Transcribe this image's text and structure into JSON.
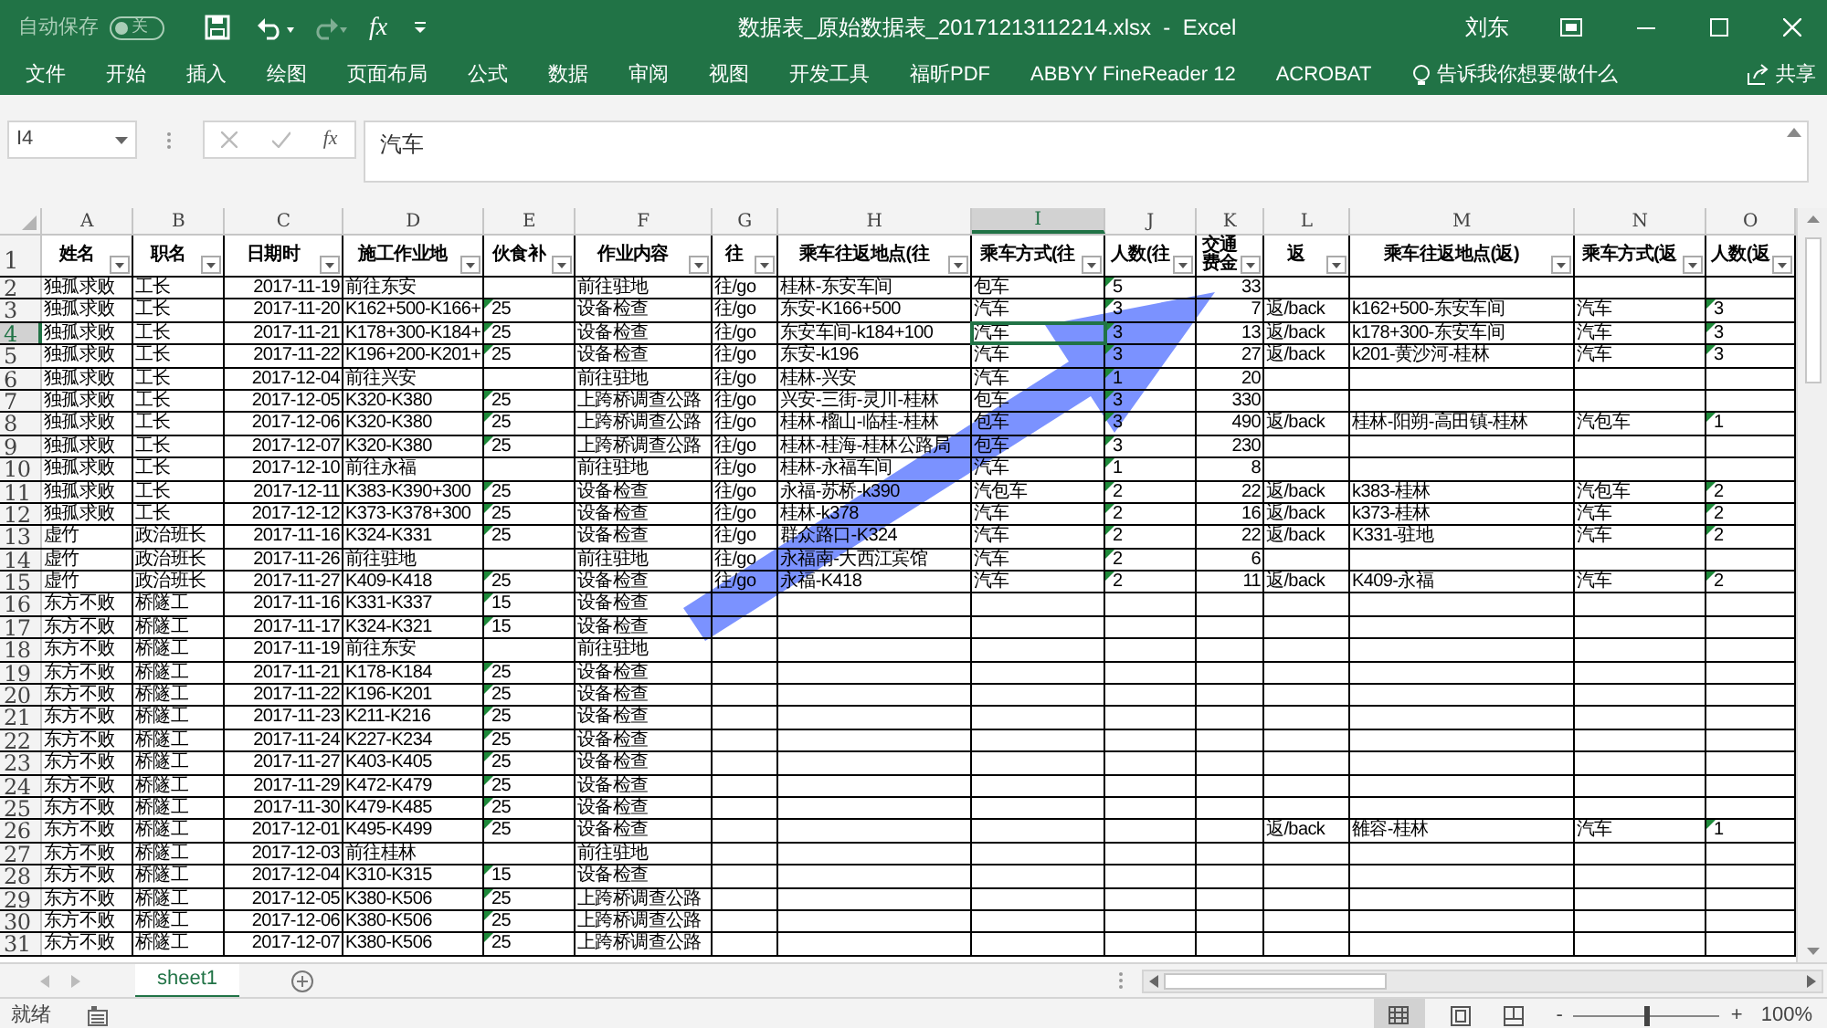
{
  "title_bar": {
    "autosave_label": "自动保存",
    "autosave_state": "关",
    "autosave_on": false,
    "fx": "fx",
    "document_title": "数据表_原始数据表_20171213112214.xlsx  -  Excel",
    "user": "刘东"
  },
  "ribbon_tabs": [
    "文件",
    "开始",
    "插入",
    "绘图",
    "页面布局",
    "公式",
    "数据",
    "审阅",
    "视图",
    "开发工具",
    "福昕PDF",
    "ABBYY FineReader 12",
    "ACROBAT"
  ],
  "tell_me": "告诉我你想要做什么",
  "share": "共享",
  "formula_bar": {
    "name_box": "I4",
    "fx": "fx",
    "formula": "汽车"
  },
  "columns": [
    {
      "letter": "A",
      "selected": false
    },
    {
      "letter": "B",
      "selected": false
    },
    {
      "letter": "C",
      "selected": false
    },
    {
      "letter": "D",
      "selected": false
    },
    {
      "letter": "E",
      "selected": false
    },
    {
      "letter": "F",
      "selected": false
    },
    {
      "letter": "G",
      "selected": false
    },
    {
      "letter": "H",
      "selected": false
    },
    {
      "letter": "I",
      "selected": true
    },
    {
      "letter": "J",
      "selected": false
    },
    {
      "letter": "K",
      "selected": false
    },
    {
      "letter": "L",
      "selected": false
    },
    {
      "letter": "M",
      "selected": false
    },
    {
      "letter": "N",
      "selected": false
    },
    {
      "letter": "O",
      "selected": false
    }
  ],
  "header_row": {
    "number": "1",
    "cells": [
      "姓名",
      "职名",
      "日期时",
      "施工作业地",
      "伙食补",
      "作业内容",
      "往",
      "乘车往返地点(往",
      "乘车方式(往",
      "人数(往",
      "交通费金",
      "返",
      "乘车往返地点(返)",
      "乘车方式(返",
      "人数(返"
    ]
  },
  "rows": [
    {
      "number": "2",
      "selected": false,
      "cells": [
        "独孤求败",
        "工长",
        "2017-11-19",
        "前往东安",
        "",
        "前往驻地",
        "往/go",
        "桂林-东安车间",
        "包车",
        {
          "text": "5",
          "flag": true
        },
        "33",
        "",
        "",
        "",
        ""
      ]
    },
    {
      "number": "3",
      "selected": false,
      "cells": [
        "独孤求败",
        "工长",
        "2017-11-20",
        "K162+500-K166+",
        {
          "text": "25",
          "flag": true
        },
        "设备检查",
        "往/go",
        "东安-K166+500",
        "汽车",
        {
          "text": "3",
          "flag": true
        },
        "7",
        "返/back",
        "k162+500-东安车间",
        "汽车",
        {
          "text": "3",
          "flag": true
        }
      ]
    },
    {
      "number": "4",
      "selected": true,
      "cells": [
        "独孤求败",
        "工长",
        "2017-11-21",
        "K178+300-K184+",
        {
          "text": "25",
          "flag": true
        },
        "设备检查",
        "往/go",
        "东安车间-k184+100",
        "汽车",
        {
          "text": "3",
          "flag": true
        },
        "13",
        "返/back",
        "k178+300-东安车间",
        "汽车",
        {
          "text": "3",
          "flag": true
        }
      ]
    },
    {
      "number": "5",
      "selected": false,
      "cells": [
        "独孤求败",
        "工长",
        "2017-11-22",
        "K196+200-K201+",
        {
          "text": "25",
          "flag": true
        },
        "设备检查",
        "往/go",
        "东安-k196",
        "汽车",
        {
          "text": "3",
          "flag": true
        },
        "27",
        "返/back",
        "k201-黄沙河-桂林",
        "汽车",
        {
          "text": "3",
          "flag": true
        }
      ]
    },
    {
      "number": "6",
      "selected": false,
      "cells": [
        "独孤求败",
        "工长",
        "2017-12-04",
        "前往兴安",
        "",
        "前往驻地",
        "往/go",
        "桂林-兴安",
        "汽车",
        {
          "text": "1",
          "flag": true
        },
        "20",
        "",
        "",
        "",
        ""
      ]
    },
    {
      "number": "7",
      "selected": false,
      "cells": [
        "独孤求败",
        "工长",
        "2017-12-05",
        "K320-K380",
        {
          "text": "25",
          "flag": true
        },
        "上跨桥调查公路",
        "往/go",
        "兴安-三街-灵川-桂林",
        "包车",
        {
          "text": "3",
          "flag": true
        },
        "330",
        "",
        "",
        "",
        ""
      ]
    },
    {
      "number": "8",
      "selected": false,
      "cells": [
        "独孤求败",
        "工长",
        "2017-12-06",
        "K320-K380",
        {
          "text": "25",
          "flag": true
        },
        "上跨桥调查公路",
        "往/go",
        "桂林-榴山-临桂-桂林",
        "包车",
        {
          "text": "3",
          "flag": true
        },
        "490",
        "返/back",
        "桂林-阳朔-高田镇-桂林",
        "汽包车",
        {
          "text": "1",
          "flag": true
        }
      ]
    },
    {
      "number": "9",
      "selected": false,
      "cells": [
        "独孤求败",
        "工长",
        "2017-12-07",
        "K320-K380",
        {
          "text": "25",
          "flag": true
        },
        "上跨桥调查公路",
        "往/go",
        "桂林-桂海-桂林公路局",
        "包车",
        {
          "text": "3",
          "flag": true
        },
        "230",
        "",
        "",
        "",
        ""
      ]
    },
    {
      "number": "10",
      "selected": false,
      "cells": [
        "独孤求败",
        "工长",
        "2017-12-10",
        "前往永福",
        "",
        "前往驻地",
        "往/go",
        "桂林-永福车间",
        "汽车",
        {
          "text": "1",
          "flag": true
        },
        "8",
        "",
        "",
        "",
        ""
      ]
    },
    {
      "number": "11",
      "selected": false,
      "cells": [
        "独孤求败",
        "工长",
        "2017-12-11",
        "K383-K390+300",
        {
          "text": "25",
          "flag": true
        },
        "设备检查",
        "往/go",
        "永福-苏桥-k390",
        "汽包车",
        {
          "text": "2",
          "flag": true
        },
        "22",
        "返/back",
        "k383-桂林",
        "汽包车",
        {
          "text": "2",
          "flag": true
        }
      ]
    },
    {
      "number": "12",
      "selected": false,
      "cells": [
        "独孤求败",
        "工长",
        "2017-12-12",
        "K373-K378+300",
        {
          "text": "25",
          "flag": true
        },
        "设备检查",
        "往/go",
        "桂林-k378",
        "汽车",
        {
          "text": "2",
          "flag": true
        },
        "16",
        "返/back",
        "k373-桂林",
        "汽车",
        {
          "text": "2",
          "flag": true
        }
      ]
    },
    {
      "number": "13",
      "selected": false,
      "cells": [
        "虚竹",
        "政治班长",
        "2017-11-16",
        "K324-K331",
        {
          "text": "25",
          "flag": true
        },
        "设备检查",
        "往/go",
        "群众路口-K324",
        "汽车",
        {
          "text": "2",
          "flag": true
        },
        "22",
        "返/back",
        "K331-驻地",
        "汽车",
        {
          "text": "2",
          "flag": true
        }
      ]
    },
    {
      "number": "14",
      "selected": false,
      "cells": [
        "虚竹",
        "政治班长",
        "2017-11-26",
        "前往驻地",
        "",
        "前往驻地",
        "往/go",
        "永福南-大西江宾馆",
        "汽车",
        {
          "text": "2",
          "flag": true
        },
        "6",
        "",
        "",
        "",
        ""
      ]
    },
    {
      "number": "15",
      "selected": false,
      "cells": [
        "虚竹",
        "政治班长",
        "2017-11-27",
        "K409-K418",
        {
          "text": "25",
          "flag": true
        },
        "设备检查",
        "往/go",
        "永福-K418",
        "汽车",
        {
          "text": "2",
          "flag": true
        },
        "11",
        "返/back",
        "K409-永福",
        "汽车",
        {
          "text": "2",
          "flag": true
        }
      ]
    },
    {
      "number": "16",
      "selected": false,
      "cells": [
        "东方不败",
        "桥隧工",
        "2017-11-16",
        "K331-K337",
        {
          "text": "15",
          "flag": true
        },
        "设备检查",
        "",
        "",
        "",
        "",
        "",
        "",
        "",
        "",
        ""
      ]
    },
    {
      "number": "17",
      "selected": false,
      "cells": [
        "东方不败",
        "桥隧工",
        "2017-11-17",
        "K324-K321",
        {
          "text": "15",
          "flag": true
        },
        "设备检查",
        "",
        "",
        "",
        "",
        "",
        "",
        "",
        "",
        ""
      ]
    },
    {
      "number": "18",
      "selected": false,
      "cells": [
        "东方不败",
        "桥隧工",
        "2017-11-19",
        "前往东安",
        "",
        "前往驻地",
        "",
        "",
        "",
        "",
        "",
        "",
        "",
        "",
        ""
      ]
    },
    {
      "number": "19",
      "selected": false,
      "cells": [
        "东方不败",
        "桥隧工",
        "2017-11-21",
        "K178-K184",
        {
          "text": "25",
          "flag": true
        },
        "设备检查",
        "",
        "",
        "",
        "",
        "",
        "",
        "",
        "",
        ""
      ]
    },
    {
      "number": "20",
      "selected": false,
      "cells": [
        "东方不败",
        "桥隧工",
        "2017-11-22",
        "K196-K201",
        {
          "text": "25",
          "flag": true
        },
        "设备检查",
        "",
        "",
        "",
        "",
        "",
        "",
        "",
        "",
        ""
      ]
    },
    {
      "number": "21",
      "selected": false,
      "cells": [
        "东方不败",
        "桥隧工",
        "2017-11-23",
        "K211-K216",
        {
          "text": "25",
          "flag": true
        },
        "设备检查",
        "",
        "",
        "",
        "",
        "",
        "",
        "",
        "",
        ""
      ]
    },
    {
      "number": "22",
      "selected": false,
      "cells": [
        "东方不败",
        "桥隧工",
        "2017-11-24",
        "K227-K234",
        {
          "text": "25",
          "flag": true
        },
        "设备检查",
        "",
        "",
        "",
        "",
        "",
        "",
        "",
        "",
        ""
      ]
    },
    {
      "number": "23",
      "selected": false,
      "cells": [
        "东方不败",
        "桥隧工",
        "2017-11-27",
        "K403-K405",
        {
          "text": "25",
          "flag": true
        },
        "设备检查",
        "",
        "",
        "",
        "",
        "",
        "",
        "",
        "",
        ""
      ]
    },
    {
      "number": "24",
      "selected": false,
      "cells": [
        "东方不败",
        "桥隧工",
        "2017-11-29",
        "K472-K479",
        {
          "text": "25",
          "flag": true
        },
        "设备检查",
        "",
        "",
        "",
        "",
        "",
        "",
        "",
        "",
        ""
      ]
    },
    {
      "number": "25",
      "selected": false,
      "cells": [
        "东方不败",
        "桥隧工",
        "2017-11-30",
        "K479-K485",
        {
          "text": "25",
          "flag": true
        },
        "设备检查",
        "",
        "",
        "",
        "",
        "",
        "",
        "",
        "",
        ""
      ]
    },
    {
      "number": "26",
      "selected": false,
      "cells": [
        "东方不败",
        "桥隧工",
        "2017-12-01",
        "K495-K499",
        {
          "text": "25",
          "flag": true
        },
        "设备检查",
        "",
        "",
        "",
        "",
        "",
        "返/back",
        "雒容-桂林",
        "汽车",
        {
          "text": "1",
          "flag": true
        }
      ]
    },
    {
      "number": "27",
      "selected": false,
      "cells": [
        "东方不败",
        "桥隧工",
        "2017-12-03",
        "前往桂林",
        "",
        "前往驻地",
        "",
        "",
        "",
        "",
        "",
        "",
        "",
        "",
        ""
      ]
    },
    {
      "number": "28",
      "selected": false,
      "cells": [
        "东方不败",
        "桥隧工",
        "2017-12-04",
        "K310-K315",
        {
          "text": "15",
          "flag": true
        },
        "设备检查",
        "",
        "",
        "",
        "",
        "",
        "",
        "",
        "",
        ""
      ]
    },
    {
      "number": "29",
      "selected": false,
      "cells": [
        "东方不败",
        "桥隧工",
        "2017-12-05",
        "K380-K506",
        {
          "text": "25",
          "flag": true
        },
        "上跨桥调查公路",
        "",
        "",
        "",
        "",
        "",
        "",
        "",
        "",
        ""
      ]
    },
    {
      "number": "30",
      "selected": false,
      "cells": [
        "东方不败",
        "桥隧工",
        "2017-12-06",
        "K380-K506",
        {
          "text": "25",
          "flag": true
        },
        "上跨桥调查公路",
        "",
        "",
        "",
        "",
        "",
        "",
        "",
        "",
        ""
      ]
    },
    {
      "number": "31",
      "selected": false,
      "cells": [
        "东方不败",
        "桥隧工",
        "2017-12-07",
        "K380-K506",
        {
          "text": "25",
          "flag": true
        },
        "上跨桥调查公路",
        "",
        "",
        "",
        "",
        "",
        "",
        "",
        "",
        ""
      ]
    }
  ],
  "sheet_tabs": [
    {
      "label": "sheet1",
      "selected": true
    }
  ],
  "status_bar": {
    "text": "就绪",
    "zoom_minus": "-",
    "zoom_plus": "+",
    "zoom_slider": {
      "level": 0.5
    },
    "zoom": "100%"
  }
}
